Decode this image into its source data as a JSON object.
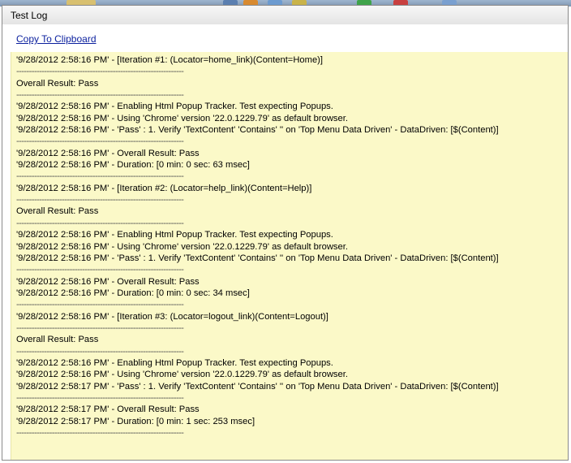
{
  "window": {
    "title": "Test Log",
    "copy_link_label": "Copy To Clipboard"
  },
  "log": {
    "lines": [
      "'9/28/2012 2:58:16 PM' - [Iteration #1: (Locator=home_link)(Content=Home)]",
      "------------------------------------------------------------------",
      "Overall Result: Pass",
      "------------------------------------------------------------------",
      "'9/28/2012 2:58:16 PM' - Enabling Html Popup Tracker. Test expecting Popups.",
      "'9/28/2012 2:58:16 PM' - Using 'Chrome' version '22.0.1229.79' as default browser.",
      "'9/28/2012 2:58:16 PM' - 'Pass' : 1. Verify 'TextContent' 'Contains' '' on 'Top Menu Data Driven' - DataDriven: [$(Content)]",
      "------------------------------------------------------------------",
      "'9/28/2012 2:58:16 PM' - Overall Result: Pass",
      "'9/28/2012 2:58:16 PM' - Duration: [0 min: 0 sec: 63 msec]",
      "------------------------------------------------------------------",
      "'9/28/2012 2:58:16 PM' - [Iteration #2: (Locator=help_link)(Content=Help)]",
      "------------------------------------------------------------------",
      "Overall Result: Pass",
      "------------------------------------------------------------------",
      "'9/28/2012 2:58:16 PM' - Enabling Html Popup Tracker. Test expecting Popups.",
      "'9/28/2012 2:58:16 PM' - Using 'Chrome' version '22.0.1229.79' as default browser.",
      "'9/28/2012 2:58:16 PM' - 'Pass' : 1. Verify 'TextContent' 'Contains' '' on 'Top Menu Data Driven' - DataDriven: [$(Content)]",
      "------------------------------------------------------------------",
      "'9/28/2012 2:58:16 PM' - Overall Result: Pass",
      "'9/28/2012 2:58:16 PM' - Duration: [0 min: 0 sec: 34 msec]",
      "------------------------------------------------------------------",
      "'9/28/2012 2:58:16 PM' - [Iteration #3: (Locator=logout_link)(Content=Logout)]",
      "------------------------------------------------------------------",
      "Overall Result: Pass",
      "------------------------------------------------------------------",
      "'9/28/2012 2:58:16 PM' - Enabling Html Popup Tracker. Test expecting Popups.",
      "'9/28/2012 2:58:16 PM' - Using 'Chrome' version '22.0.1229.79' as default browser.",
      "'9/28/2012 2:58:17 PM' - 'Pass' : 1. Verify 'TextContent' 'Contains' '' on 'Top Menu Data Driven' - DataDriven: [$(Content)]",
      "------------------------------------------------------------------",
      "'9/28/2012 2:58:17 PM' - Overall Result: Pass",
      "'9/28/2012 2:58:17 PM' - Duration: [0 min: 1 sec: 253 msec]",
      "------------------------------------------------------------------"
    ]
  }
}
